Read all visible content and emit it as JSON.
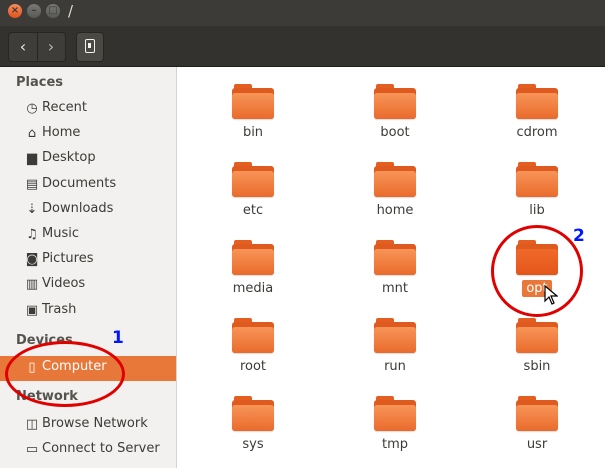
{
  "window": {
    "title": "/"
  },
  "sidebar": {
    "places_header": "Places",
    "places": [
      {
        "label": "Recent",
        "icon": "clock-icon"
      },
      {
        "label": "Home",
        "icon": "home-icon"
      },
      {
        "label": "Desktop",
        "icon": "desktop-icon"
      },
      {
        "label": "Documents",
        "icon": "document-icon"
      },
      {
        "label": "Downloads",
        "icon": "download-icon"
      },
      {
        "label": "Music",
        "icon": "music-icon"
      },
      {
        "label": "Pictures",
        "icon": "camera-icon"
      },
      {
        "label": "Videos",
        "icon": "film-icon"
      },
      {
        "label": "Trash",
        "icon": "trash-icon"
      }
    ],
    "devices_header": "Devices",
    "devices": [
      {
        "label": "Computer",
        "icon": "drive-icon",
        "selected": true
      }
    ],
    "network_header": "Network",
    "network": [
      {
        "label": "Browse Network",
        "icon": "network-icon"
      },
      {
        "label": "Connect to Server",
        "icon": "server-icon"
      }
    ]
  },
  "folders": [
    "bin",
    "boot",
    "cdrom",
    "etc",
    "home",
    "lib",
    "media",
    "mnt",
    "opt",
    "root",
    "run",
    "sbin",
    "sys",
    "tmp",
    "usr"
  ],
  "selected_folder": "opt",
  "annotations": {
    "label_1": "1",
    "label_2": "2",
    "color": "#e00000",
    "number_color": "#0018ff"
  },
  "colors": {
    "accent": "#e8783a",
    "folder": "#f07f3c"
  }
}
